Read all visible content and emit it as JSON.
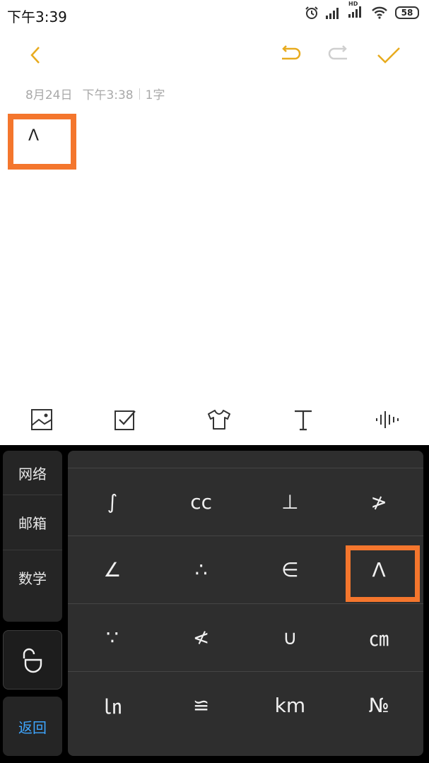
{
  "status_bar": {
    "time": "下午3:39",
    "hd_label": "HD",
    "battery": "58"
  },
  "header": {
    "back_icon": "chevron-left-icon",
    "undo_icon": "undo-icon",
    "redo_icon": "redo-icon",
    "done_icon": "check-icon",
    "accent_color": "#e8ab1e"
  },
  "note": {
    "date": "8月24日",
    "time": "下午3:38",
    "char_count": "1字",
    "content": "Λ"
  },
  "toolbar": {
    "icons": [
      "image-icon",
      "checkbox-icon",
      "theme-shirt-icon",
      "text-format-icon",
      "voice-icon"
    ]
  },
  "keyboard": {
    "categories": [
      "网络",
      "邮箱",
      "数学"
    ],
    "back_label": "返回",
    "back_color": "#3ea6ff",
    "rows": [
      [
        "∫",
        "cc",
        "⊥",
        "≯"
      ],
      [
        "∠",
        "∴",
        "∈",
        "Λ"
      ],
      [
        "∵",
        "≮",
        "∪",
        "㎝"
      ],
      [
        "㏑",
        "≌",
        "km",
        "№"
      ]
    ]
  },
  "highlight_color": "#f4762d"
}
